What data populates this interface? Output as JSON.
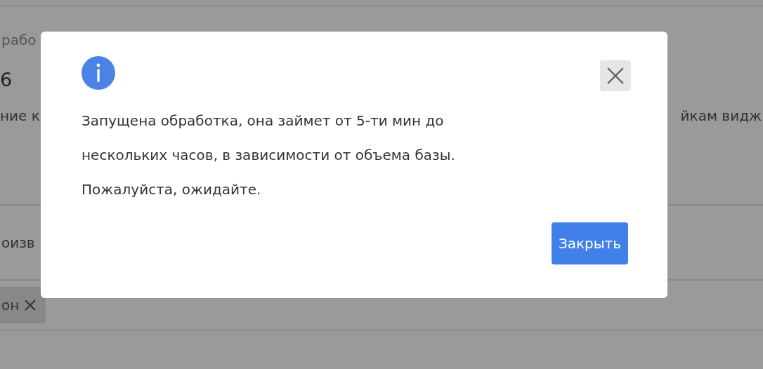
{
  "background": {
    "left_texts": [
      "рабо",
      "6",
      "ние к",
      "оизв"
    ],
    "right_text": "йкам видж",
    "tag": {
      "label": "он"
    }
  },
  "dialog": {
    "message": "Запущена обработка, она займет от 5-ти мин до нескольких часов, в зависимости от объема базы. Пожалуйста, ожидайте.",
    "buttons": [
      {
        "label": "Закрыть",
        "kind": "primary"
      }
    ]
  }
}
